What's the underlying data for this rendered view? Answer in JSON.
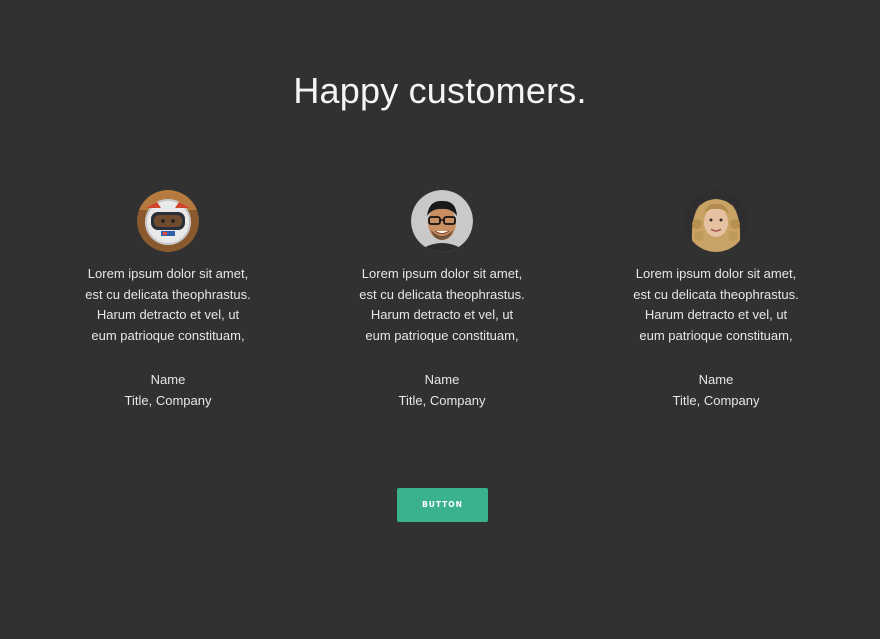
{
  "heading": "Happy customers.",
  "testimonials": [
    {
      "avatar": "astronaut-helmet-avatar",
      "quote_lines": [
        "Lorem ipsum dolor sit amet,",
        "est cu delicata theophrastus.",
        "Harum detracto et vel, ut",
        "eum patrioque constituam,"
      ],
      "name": "Name",
      "title": "Title, Company"
    },
    {
      "avatar": "man-with-glasses-avatar",
      "quote_lines": [
        "Lorem ipsum dolor sit amet,",
        "est cu delicata theophrastus.",
        "Harum detracto et vel, ut",
        "eum patrioque constituam,"
      ],
      "name": "Name",
      "title": "Title, Company"
    },
    {
      "avatar": "curly-hair-woman-avatar",
      "quote_lines": [
        "Lorem ipsum dolor sit amet,",
        "est cu delicata theophrastus.",
        "Harum detracto et vel, ut",
        "eum patrioque constituam,"
      ],
      "name": "Name",
      "title": "Title, Company"
    }
  ],
  "button_label": "BUTTON",
  "colors": {
    "background": "#313131",
    "accent": "#3bb28e",
    "text": "#f2f2f2"
  }
}
